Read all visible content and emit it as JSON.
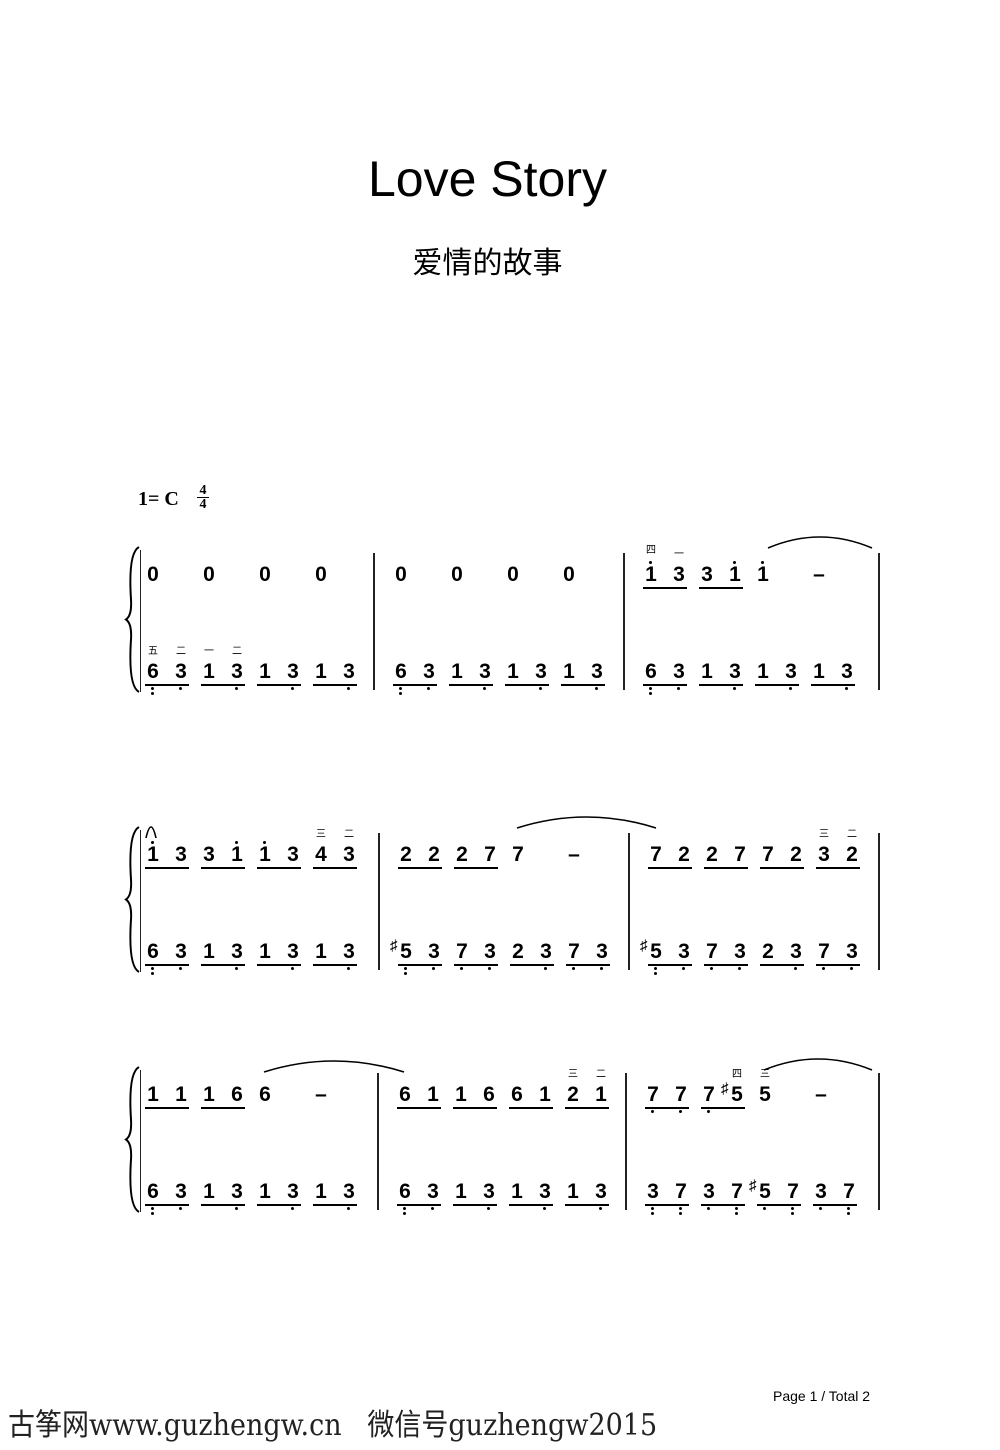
{
  "header": {
    "title": "Love Story",
    "subtitle": "爱情的故事",
    "key": "1= C",
    "time_signature": {
      "top": "4",
      "bottom": "4"
    }
  },
  "systems": [
    {
      "measures": [
        {
          "upper": [
            {
              "n": "0",
              "d": 2
            },
            {
              "n": "0",
              "d": 2
            },
            {
              "n": "0",
              "d": 2
            },
            {
              "n": "0",
              "d": 2
            }
          ],
          "lower": [
            {
              "n": "6",
              "lo": 2,
              "f": "五"
            },
            {
              "n": "3",
              "lo": 1,
              "f": "二"
            },
            {
              "n": "1",
              "f": "一"
            },
            {
              "n": "3",
              "lo": 1,
              "f": "二"
            },
            {
              "n": "1"
            },
            {
              "n": "3",
              "lo": 1
            },
            {
              "n": "1"
            },
            {
              "n": "3",
              "lo": 1
            }
          ]
        },
        {
          "upper": [
            {
              "n": "0",
              "d": 2
            },
            {
              "n": "0",
              "d": 2
            },
            {
              "n": "0",
              "d": 2
            },
            {
              "n": "0",
              "d": 2
            }
          ],
          "lower": [
            {
              "n": "6",
              "lo": 2
            },
            {
              "n": "3",
              "lo": 1
            },
            {
              "n": "1"
            },
            {
              "n": "3",
              "lo": 1
            },
            {
              "n": "1"
            },
            {
              "n": "3",
              "lo": 1
            },
            {
              "n": "1"
            },
            {
              "n": "3",
              "lo": 1
            }
          ]
        },
        {
          "upper": [
            {
              "n": "1",
              "hi": 1,
              "f": "四"
            },
            {
              "n": "3",
              "f": "一"
            },
            {
              "n": "3"
            },
            {
              "n": "1",
              "hi": 1
            },
            {
              "n": "1",
              "hi": 1,
              "d": 2
            },
            {
              "n": "–",
              "d": 2
            }
          ],
          "lower": [
            {
              "n": "6",
              "lo": 2
            },
            {
              "n": "3",
              "lo": 1
            },
            {
              "n": "1"
            },
            {
              "n": "3",
              "lo": 1
            },
            {
              "n": "1"
            },
            {
              "n": "3",
              "lo": 1
            },
            {
              "n": "1"
            },
            {
              "n": "3",
              "lo": 1
            }
          ]
        }
      ]
    },
    {
      "measures": [
        {
          "upper": [
            {
              "n": "1",
              "hi": 1
            },
            {
              "n": "3"
            },
            {
              "n": "3"
            },
            {
              "n": "1",
              "hi": 1
            },
            {
              "n": "1",
              "hi": 1
            },
            {
              "n": "3"
            },
            {
              "n": "4",
              "f": "三"
            },
            {
              "n": "3",
              "f": "二"
            }
          ],
          "lower": [
            {
              "n": "6",
              "lo": 2
            },
            {
              "n": "3",
              "lo": 1
            },
            {
              "n": "1"
            },
            {
              "n": "3",
              "lo": 1
            },
            {
              "n": "1"
            },
            {
              "n": "3",
              "lo": 1
            },
            {
              "n": "1"
            },
            {
              "n": "3",
              "lo": 1
            }
          ]
        },
        {
          "upper": [
            {
              "n": "2"
            },
            {
              "n": "2"
            },
            {
              "n": "2"
            },
            {
              "n": "7"
            },
            {
              "n": "7",
              "d": 2
            },
            {
              "n": "–",
              "d": 2
            }
          ],
          "lower": [
            {
              "n": "5",
              "sharp": true,
              "lo": 2
            },
            {
              "n": "3",
              "lo": 1
            },
            {
              "n": "7",
              "lo": 1
            },
            {
              "n": "3",
              "lo": 1
            },
            {
              "n": "2"
            },
            {
              "n": "3",
              "lo": 1
            },
            {
              "n": "7",
              "lo": 1
            },
            {
              "n": "3",
              "lo": 1
            }
          ]
        },
        {
          "upper": [
            {
              "n": "7"
            },
            {
              "n": "2"
            },
            {
              "n": "2"
            },
            {
              "n": "7"
            },
            {
              "n": "7"
            },
            {
              "n": "2"
            },
            {
              "n": "3",
              "f": "三"
            },
            {
              "n": "2",
              "f": "二"
            }
          ],
          "lower": [
            {
              "n": "5",
              "sharp": true,
              "lo": 2
            },
            {
              "n": "3",
              "lo": 1
            },
            {
              "n": "7",
              "lo": 1
            },
            {
              "n": "3",
              "lo": 1
            },
            {
              "n": "2"
            },
            {
              "n": "3",
              "lo": 1
            },
            {
              "n": "7",
              "lo": 1
            },
            {
              "n": "3",
              "lo": 1
            }
          ]
        }
      ]
    },
    {
      "measures": [
        {
          "upper": [
            {
              "n": "1"
            },
            {
              "n": "1"
            },
            {
              "n": "1"
            },
            {
              "n": "6"
            },
            {
              "n": "6",
              "d": 2
            },
            {
              "n": "–",
              "d": 2
            }
          ],
          "lower": [
            {
              "n": "6",
              "lo": 2
            },
            {
              "n": "3",
              "lo": 1
            },
            {
              "n": "1"
            },
            {
              "n": "3",
              "lo": 1
            },
            {
              "n": "1"
            },
            {
              "n": "3",
              "lo": 1
            },
            {
              "n": "1"
            },
            {
              "n": "3",
              "lo": 1
            }
          ]
        },
        {
          "upper": [
            {
              "n": "6"
            },
            {
              "n": "1"
            },
            {
              "n": "1"
            },
            {
              "n": "6"
            },
            {
              "n": "6"
            },
            {
              "n": "1"
            },
            {
              "n": "2",
              "f": "三"
            },
            {
              "n": "1",
              "f": "二"
            }
          ],
          "lower": [
            {
              "n": "6",
              "lo": 2
            },
            {
              "n": "3",
              "lo": 1
            },
            {
              "n": "1"
            },
            {
              "n": "3",
              "lo": 1
            },
            {
              "n": "1"
            },
            {
              "n": "3",
              "lo": 1
            },
            {
              "n": "1"
            },
            {
              "n": "3",
              "lo": 1
            }
          ]
        },
        {
          "upper": [
            {
              "n": "7",
              "lo": 1
            },
            {
              "n": "7",
              "lo": 1
            },
            {
              "n": "7",
              "lo": 1
            },
            {
              "n": "5",
              "sharp": true,
              "f": "四"
            },
            {
              "n": "5",
              "d": 2,
              "f": "三"
            },
            {
              "n": "–",
              "d": 2
            }
          ],
          "lower": [
            {
              "n": "3",
              "lo": 2
            },
            {
              "n": "7",
              "lo": 2
            },
            {
              "n": "3",
              "lo": 1
            },
            {
              "n": "7",
              "lo": 2
            },
            {
              "n": "5",
              "sharp": true,
              "lo": 1
            },
            {
              "n": "7",
              "lo": 2
            },
            {
              "n": "3",
              "lo": 1
            },
            {
              "n": "7",
              "lo": 2
            }
          ]
        }
      ]
    }
  ],
  "footer": {
    "watermark": "古筝网www.guzhengw.cn   微信号guzhengw2015",
    "page": "Page 1 / Total 2"
  }
}
